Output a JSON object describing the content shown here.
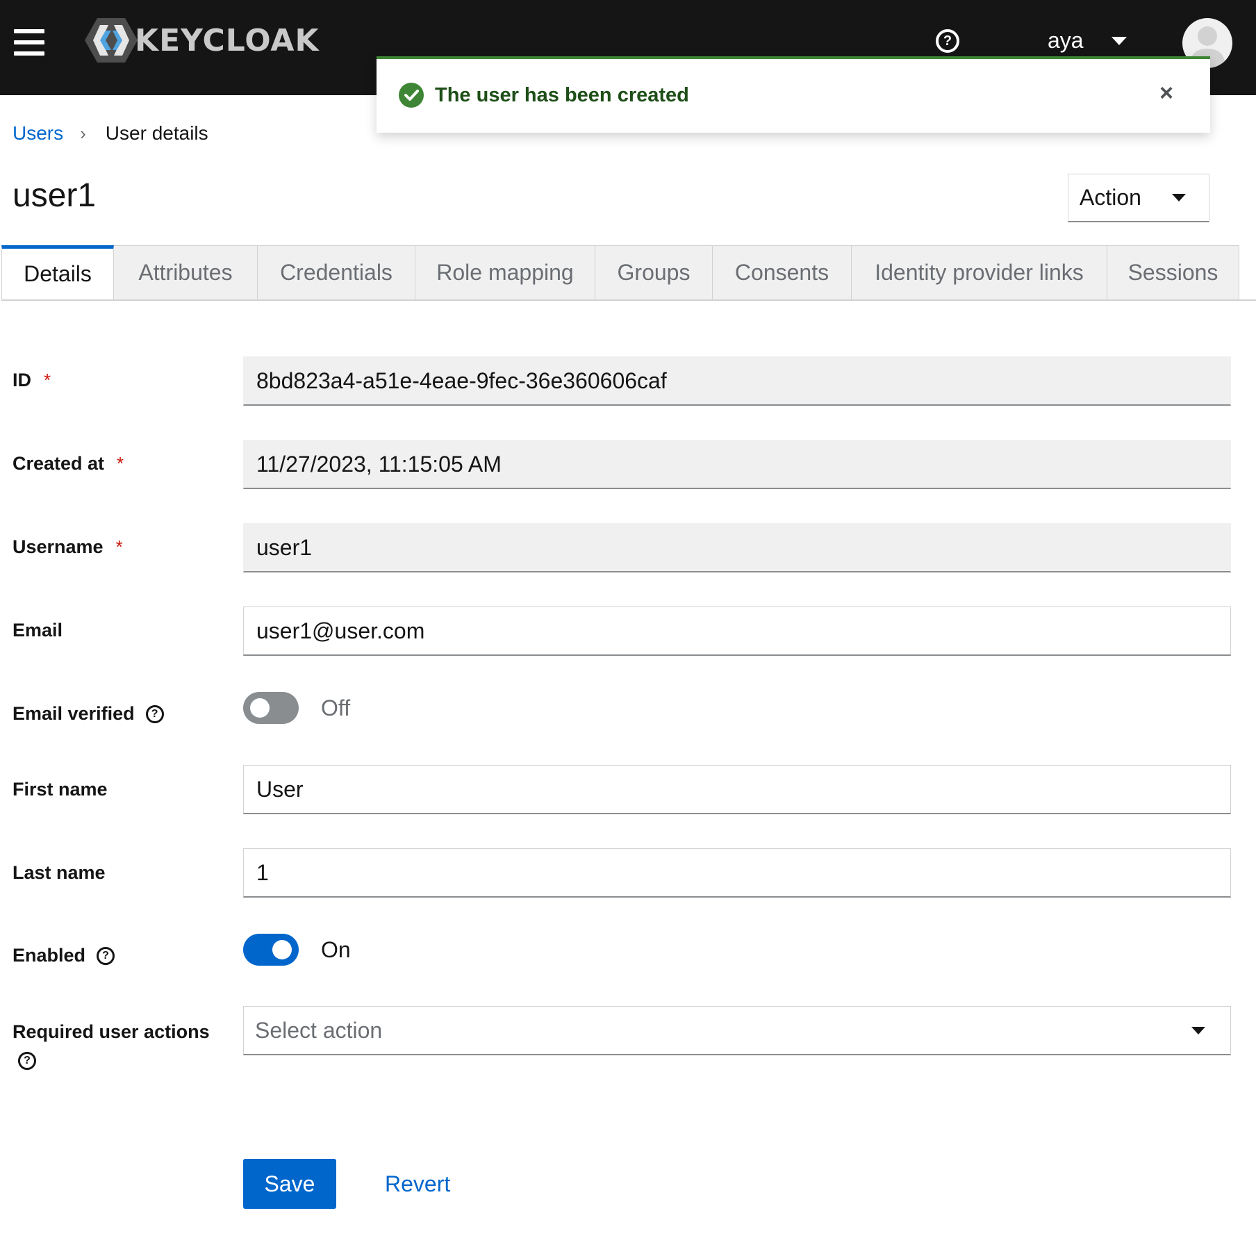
{
  "header": {
    "brand": "KEYCLOAK",
    "username": "aya"
  },
  "toast": {
    "title": "The user has been created",
    "variant": "success",
    "close_label": "×"
  },
  "breadcrumb": {
    "parent": "Users",
    "current": "User details"
  },
  "page": {
    "title": "user1",
    "action_label": "Action"
  },
  "tabs": [
    {
      "label": "Details",
      "active": true
    },
    {
      "label": "Attributes"
    },
    {
      "label": "Credentials"
    },
    {
      "label": "Role mapping"
    },
    {
      "label": "Groups"
    },
    {
      "label": "Consents"
    },
    {
      "label": "Identity provider links"
    },
    {
      "label": "Sessions"
    }
  ],
  "form": {
    "id": {
      "label": "ID",
      "value": "8bd823a4-a51e-4eae-9fec-36e360606caf"
    },
    "created_at": {
      "label": "Created at",
      "value": "11/27/2023, 11:15:05 AM"
    },
    "username": {
      "label": "Username",
      "value": "user1"
    },
    "email": {
      "label": "Email",
      "value": "user1@user.com"
    },
    "email_verified": {
      "label": "Email verified",
      "state": "Off"
    },
    "first_name": {
      "label": "First name",
      "value": "User"
    },
    "last_name": {
      "label": "Last name",
      "value": "1"
    },
    "enabled": {
      "label": "Enabled",
      "state": "On"
    },
    "required_actions": {
      "label": "Required user actions",
      "placeholder": "Select action"
    },
    "required_marker": "*"
  },
  "buttons": {
    "save": "Save",
    "revert": "Revert"
  },
  "colors": {
    "primary": "#0066cc",
    "success": "#3e8635",
    "masthead": "#151515",
    "required": "#c9190b"
  }
}
